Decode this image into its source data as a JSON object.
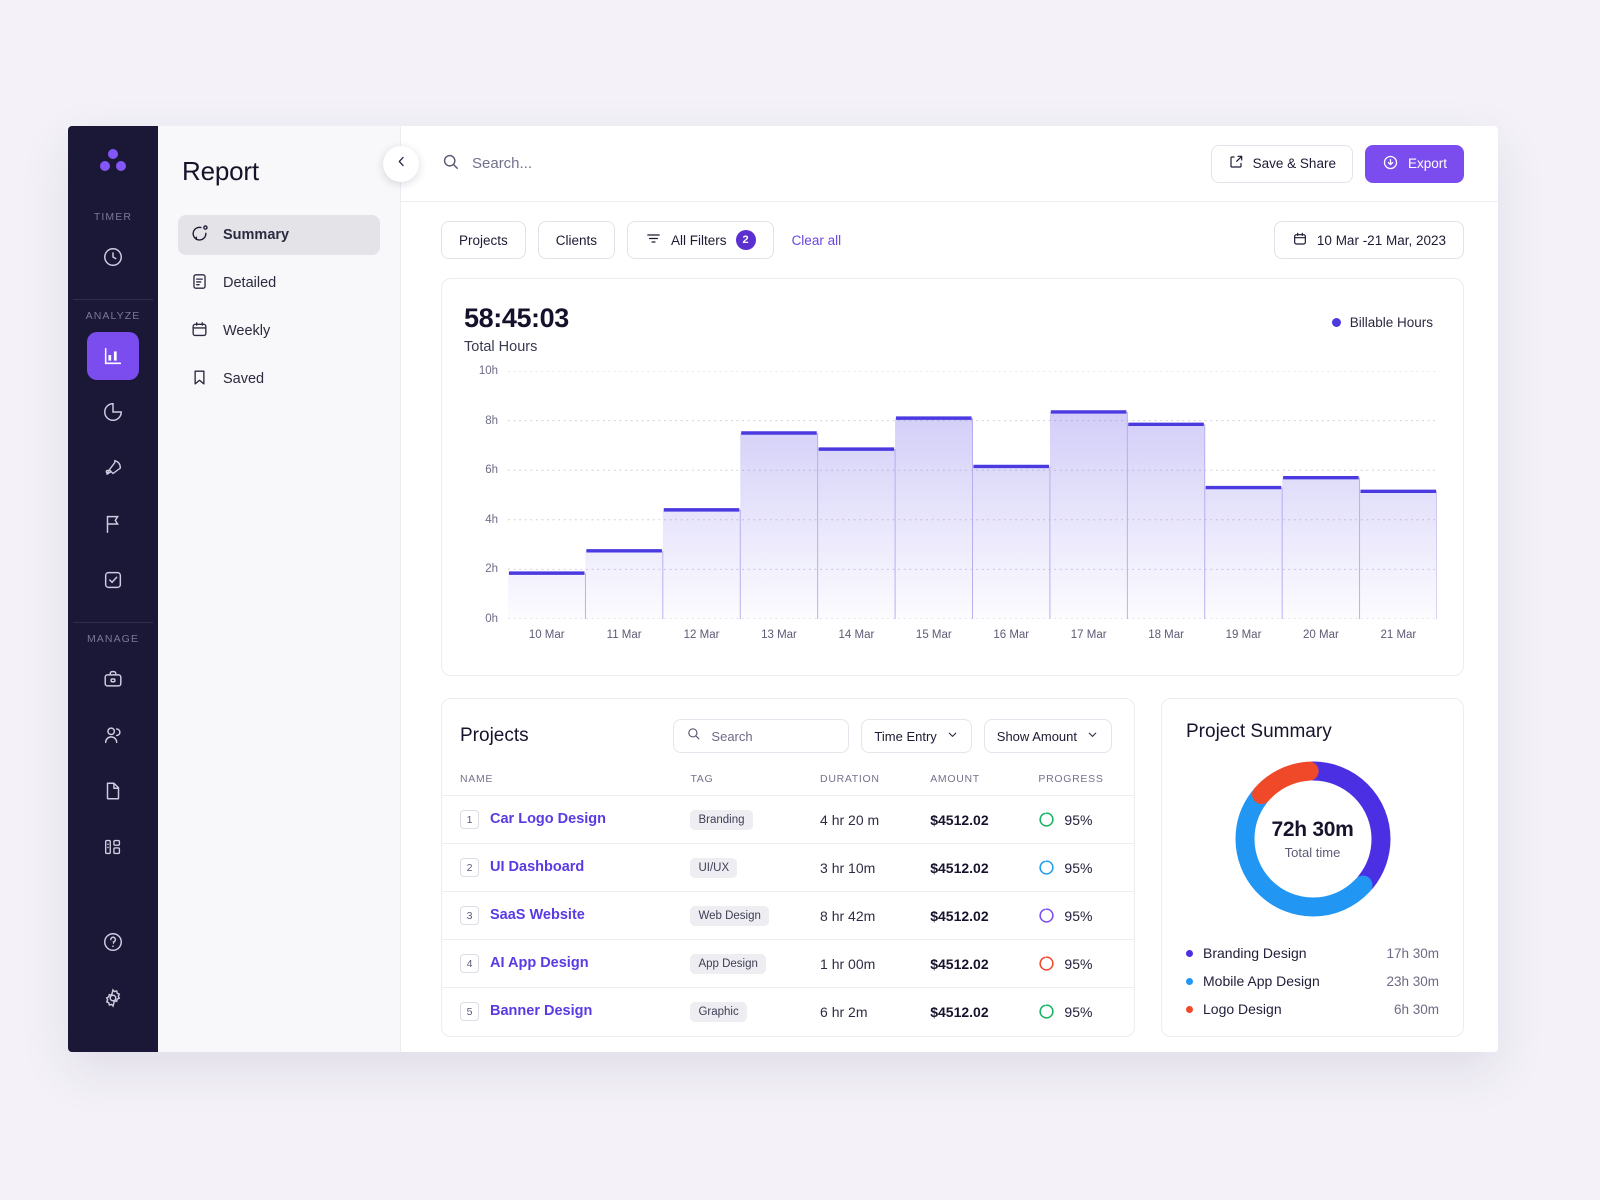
{
  "rail": {
    "logo_name": "app-logo",
    "groups": [
      {
        "label": "TIMER",
        "icons": [
          "clock-icon"
        ]
      },
      {
        "label": "ANALYZE",
        "icons": [
          "bar-chart-icon",
          "pie-chart-icon",
          "rocket-icon",
          "flag-icon",
          "check-square-icon"
        ]
      },
      {
        "label": "MANAGE",
        "icons": [
          "briefcase-icon",
          "users-icon",
          "file-icon",
          "kanban-icon"
        ]
      }
    ],
    "bottom_icons": [
      "help-circle-icon",
      "settings-gear-icon"
    ]
  },
  "reportnav": {
    "title": "Report",
    "items": [
      {
        "label": "Summary",
        "icon": "chat-badge-icon",
        "active": true
      },
      {
        "label": "Detailed",
        "icon": "document-lines-icon",
        "active": false
      },
      {
        "label": "Weekly",
        "icon": "calendar-icon",
        "active": false
      },
      {
        "label": "Saved",
        "icon": "bookmark-icon",
        "active": false
      }
    ]
  },
  "topbar": {
    "collapse_icon": "chevron-left-icon",
    "search_placeholder": "Search...",
    "search_value": "",
    "save_share_label": "Save & Share",
    "export_label": "Export"
  },
  "filterbar": {
    "projects_label": "Projects",
    "clients_label": "Clients",
    "all_filters_label": "All Filters",
    "all_filters_count": "2",
    "clear_all_label": "Clear all",
    "date_range": "10 Mar -21 Mar, 2023"
  },
  "chart_card": {
    "total_hours": "58:45:03",
    "total_hours_label": "Total Hours",
    "legend_label": "Billable Hours"
  },
  "chart_data": {
    "type": "area",
    "title": "Billable Hours",
    "xlabel": "",
    "ylabel": "",
    "ylim": [
      0,
      10
    ],
    "yticks": [
      "0h",
      "2h",
      "4h",
      "6h",
      "8h",
      "10h"
    ],
    "ytick_values": [
      0,
      2,
      4,
      6,
      8,
      10
    ],
    "grid": true,
    "legend_position": "top-right",
    "accent": "#4b3ae0",
    "categories": [
      "10 Mar",
      "11 Mar",
      "12 Mar",
      "13 Mar",
      "14 Mar",
      "15 Mar",
      "16 Mar",
      "17 Mar",
      "18 Mar",
      "19 Mar",
      "20 Mar",
      "21 Mar"
    ],
    "series": [
      {
        "name": "Billable Hours",
        "values": [
          1.85,
          2.75,
          4.4,
          7.5,
          6.85,
          8.1,
          6.15,
          8.35,
          7.85,
          5.3,
          5.7,
          5.15
        ]
      }
    ]
  },
  "projects": {
    "title": "Projects",
    "search_placeholder": "Search",
    "search_value": "",
    "time_entry_label": "Time Entry",
    "show_amount_label": "Show Amount",
    "columns": [
      "NAME",
      "TAG",
      "DURATION",
      "AMOUNT",
      "PROGRESS"
    ],
    "rows": [
      {
        "num": "1",
        "name": "Car Logo Design",
        "tag": "Branding",
        "duration": "4 hr 20 m",
        "amount": "$4512.02",
        "progress": "95%",
        "ring_color": "#16b364"
      },
      {
        "num": "2",
        "name": "UI Dashboard",
        "tag": "UI/UX",
        "duration": "3 hr 10m",
        "amount": "$4512.02",
        "progress": "95%",
        "ring_color": "#1f9cf0"
      },
      {
        "num": "3",
        "name": "SaaS Website",
        "tag": "Web Design",
        "duration": "8 hr 42m",
        "amount": "$4512.02",
        "progress": "95%",
        "ring_color": "#7b4dee"
      },
      {
        "num": "4",
        "name": "AI App Design",
        "tag": "App Design",
        "duration": "1 hr 00m",
        "amount": "$4512.02",
        "progress": "95%",
        "ring_color": "#f0492a"
      },
      {
        "num": "5",
        "name": "Banner Design",
        "tag": "Graphic",
        "duration": "6 hr 2m",
        "amount": "$4512.02",
        "progress": "95%",
        "ring_color": "#16b364"
      }
    ]
  },
  "project_summary": {
    "title": "Project Summary",
    "center_value": "72h 30m",
    "center_label": "Total time",
    "donut": {
      "type": "pie",
      "total_hours": 72.5,
      "slices": [
        {
          "name": "Branding Design",
          "value": 17.5,
          "display": "17h 30m",
          "color": "#4b2fe3"
        },
        {
          "name": "Mobile App Design",
          "value": 23.5,
          "display": "23h 30m",
          "color": "#2196f3"
        },
        {
          "name": "Logo Design",
          "value": 6.5,
          "display": "6h 30m",
          "color": "#f0492a"
        }
      ]
    }
  }
}
